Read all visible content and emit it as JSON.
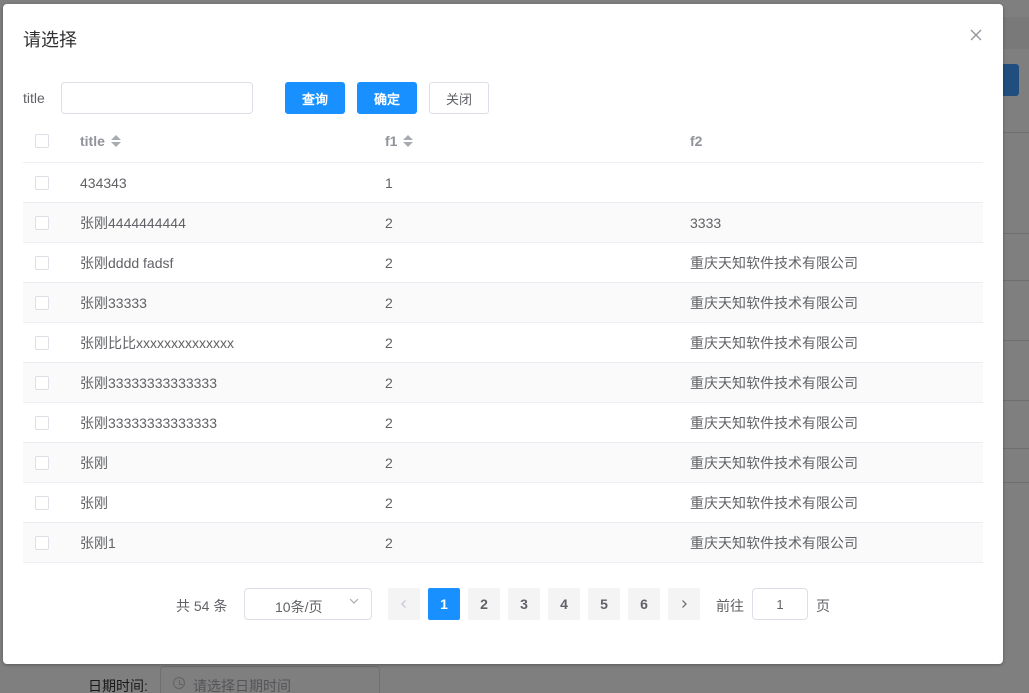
{
  "background": {
    "form_label": "日期时间:",
    "form_placeholder": "请选择日期时间"
  },
  "dialog": {
    "title": "请选择",
    "search": {
      "label": "title",
      "value": "",
      "placeholder": ""
    },
    "buttons": {
      "query": "查询",
      "confirm": "确定",
      "close": "关闭"
    },
    "table": {
      "columns": [
        "title",
        "f1",
        "f2"
      ],
      "rows": [
        {
          "title": "434343",
          "f1": "1",
          "f2": ""
        },
        {
          "title": "张刚4444444444",
          "f1": "2",
          "f2": "3333"
        },
        {
          "title": "张刚dddd fadsf",
          "f1": "2",
          "f2": "重庆天知软件技术有限公司"
        },
        {
          "title": "张刚33333",
          "f1": "2",
          "f2": "重庆天知软件技术有限公司"
        },
        {
          "title": "张刚比比xxxxxxxxxxxxxx",
          "f1": "2",
          "f2": "重庆天知软件技术有限公司"
        },
        {
          "title": "张刚33333333333333",
          "f1": "2",
          "f2": "重庆天知软件技术有限公司"
        },
        {
          "title": "张刚33333333333333",
          "f1": "2",
          "f2": "重庆天知软件技术有限公司"
        },
        {
          "title": "张刚",
          "f1": "2",
          "f2": "重庆天知软件技术有限公司"
        },
        {
          "title": "张刚",
          "f1": "2",
          "f2": "重庆天知软件技术有限公司"
        },
        {
          "title": "张刚1",
          "f1": "2",
          "f2": "重庆天知软件技术有限公司"
        }
      ]
    },
    "pagination": {
      "total": "共 54 条",
      "page_size": "10条/页",
      "pages": [
        "1",
        "2",
        "3",
        "4",
        "5",
        "6"
      ],
      "current_page": "1",
      "goto_label": "前往",
      "goto_value": "1",
      "goto_suffix": "页"
    }
  },
  "colors": {
    "primary": "#1890ff",
    "text": "#606266",
    "header_text": "#909399",
    "border": "#dcdfe6"
  }
}
